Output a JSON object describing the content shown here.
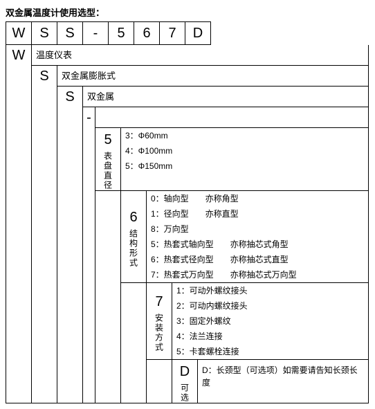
{
  "title": "双金属温度计使用选型：",
  "code": [
    "W",
    "S",
    "S",
    "-",
    "5",
    "6",
    "7",
    "D"
  ],
  "levels": {
    "W": {
      "label": "W",
      "desc": "温度仪表"
    },
    "S1": {
      "label": "S",
      "desc": "双金属膨胀式"
    },
    "S2": {
      "label": "S",
      "desc": "双金属"
    },
    "dash": {
      "label": "-",
      "desc": ""
    },
    "L5": {
      "label": "5",
      "sub": "表盘直径",
      "items": [
        "3：Φ60mm",
        "4：Φ100mm",
        "5：Φ150mm"
      ]
    },
    "L6": {
      "label": "6",
      "sub": "结构形式",
      "items": [
        "0：轴向型　　亦称角型",
        "1：径向型　　亦称直型",
        "8：万向型",
        "5：热套式轴向型　　亦称抽芯式角型",
        "6：热套式径向型　　亦称抽芯式直型",
        "7：热套式万向型　　亦称抽芯式万向型"
      ]
    },
    "L7": {
      "label": "7",
      "sub": "安装方式",
      "items": [
        "1：可动外螺纹接头",
        "2：可动内螺纹接头",
        "3：固定外螺纹",
        "4：法兰连接",
        "5：卡套螺栓连接"
      ]
    },
    "LD": {
      "label": "D",
      "sub": "可选",
      "items": [
        "D：长颈型（可选项）如需要请告知长颈长度"
      ]
    }
  }
}
